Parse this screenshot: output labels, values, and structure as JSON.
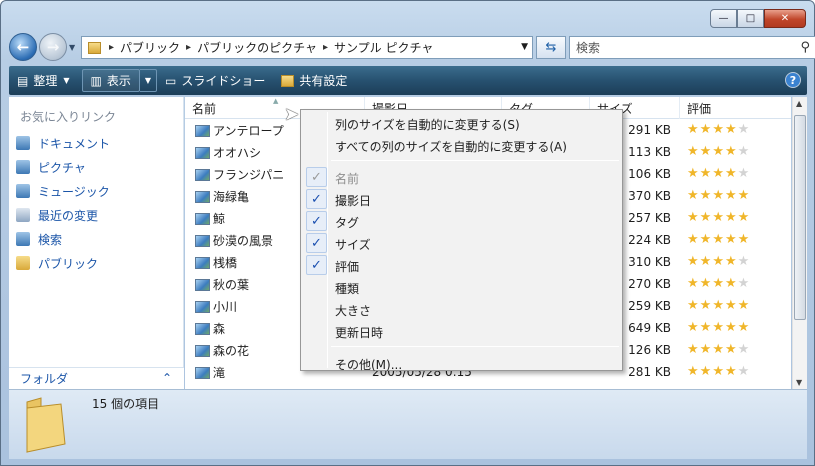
{
  "window": {
    "caption_buttons": {
      "minimize": "—",
      "maximize": "□",
      "close": "✕"
    }
  },
  "address": {
    "segments": [
      "パブリック",
      "パブリックのピクチャ",
      "サンプル ピクチャ"
    ],
    "separator": "▸",
    "search_placeholder": "検索"
  },
  "toolbar": {
    "organize": "整理",
    "views": "表示",
    "slideshow": "スライドショー",
    "share": "共有設定",
    "help": "?"
  },
  "sidebar": {
    "favorites_title": "お気に入りリンク",
    "items": [
      {
        "label": "ドキュメント",
        "icon": "documents-icon"
      },
      {
        "label": "ピクチャ",
        "icon": "pictures-icon"
      },
      {
        "label": "ミュージック",
        "icon": "music-icon"
      },
      {
        "label": "最近の変更",
        "icon": "recent-icon"
      },
      {
        "label": "検索",
        "icon": "search-folder-icon"
      },
      {
        "label": "パブリック",
        "icon": "public-folder-icon"
      }
    ],
    "folders_label": "フォルダ",
    "folders_chevron": "⌃"
  },
  "columns": {
    "name": "名前",
    "date": "撮影日",
    "tag": "タグ",
    "size": "サイズ",
    "rating": "評価"
  },
  "files": [
    {
      "name": "アンテロープ",
      "size": "291 KB",
      "rating": 4
    },
    {
      "name": "オオハシ",
      "size": "113 KB",
      "rating": 4
    },
    {
      "name": "フランジパニ",
      "size": "106 KB",
      "rating": 4
    },
    {
      "name": "海緑亀",
      "size": "370 KB",
      "rating": 5
    },
    {
      "name": "鯨",
      "size": "257 KB",
      "rating": 5
    },
    {
      "name": "砂漠の風景",
      "size": "224 KB",
      "rating": 5
    },
    {
      "name": "桟橋",
      "size": "310 KB",
      "rating": 4
    },
    {
      "name": "秋の葉",
      "size": "270 KB",
      "rating": 4
    },
    {
      "name": "小川",
      "size": "259 KB",
      "rating": 5
    },
    {
      "name": "森",
      "size": "649 KB",
      "rating": 5
    },
    {
      "name": "森の花",
      "size": "126 KB",
      "rating": 4
    },
    {
      "name": "滝",
      "date": "2005/05/28 0:15",
      "size": "281 KB",
      "rating": 4
    }
  ],
  "status": {
    "count": "15 個の項目"
  },
  "context_menu": {
    "items": [
      {
        "label": "列のサイズを自動的に変更する(S)",
        "checked": false,
        "disabled": false
      },
      {
        "label": "すべての列のサイズを自動的に変更する(A)",
        "checked": false,
        "disabled": false
      },
      {
        "label": "名前",
        "checked": true,
        "disabled": true
      },
      {
        "label": "撮影日",
        "checked": true,
        "disabled": false
      },
      {
        "label": "タグ",
        "checked": true,
        "disabled": false
      },
      {
        "label": "サイズ",
        "checked": true,
        "disabled": false
      },
      {
        "label": "評価",
        "checked": true,
        "disabled": false
      },
      {
        "label": "種類",
        "checked": false,
        "disabled": false
      },
      {
        "label": "大きさ",
        "checked": false,
        "disabled": false
      },
      {
        "label": "更新日時",
        "checked": false,
        "disabled": false
      },
      {
        "label": "その他(M)...",
        "checked": false,
        "disabled": false
      }
    ],
    "check_glyph": "✓"
  }
}
